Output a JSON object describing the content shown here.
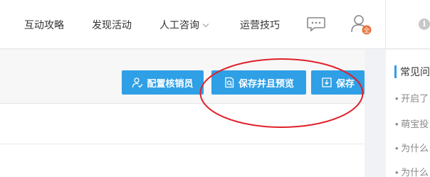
{
  "nav": {
    "items": [
      {
        "label": "互动攻略"
      },
      {
        "label": "发现活动"
      },
      {
        "label": "人工咨询"
      },
      {
        "label": "运营技巧"
      }
    ],
    "user_badge": "全"
  },
  "toolbar": {
    "config_label": "配置核销员",
    "save_preview_label": "保存并且预览",
    "save_label": "保存"
  },
  "side": {
    "title": "常见问",
    "items": [
      {
        "label": "• 开启了"
      },
      {
        "label": "• 萌宝投"
      },
      {
        "label": "• 为什么"
      },
      {
        "label": "• 为什么"
      }
    ]
  },
  "colors": {
    "accent": "#2f9fe6",
    "annotation": "#e0202a",
    "badge": "#e8743b"
  },
  "icons": [
    "chevron-down-icon",
    "message-icon",
    "user-icon",
    "info-icon",
    "user-check-icon",
    "preview-icon",
    "save-icon"
  ]
}
